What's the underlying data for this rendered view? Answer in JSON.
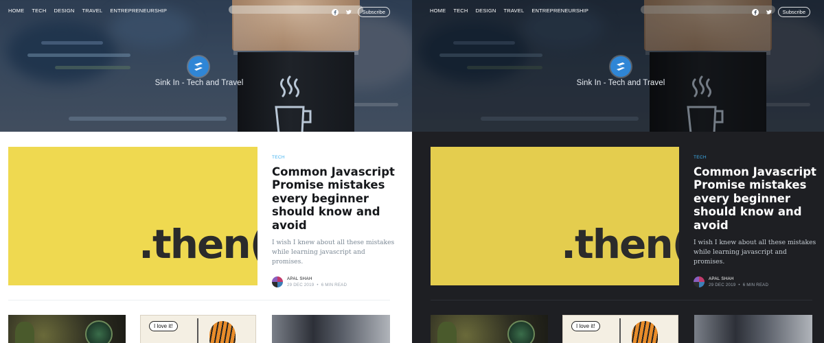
{
  "nav": {
    "items": [
      "HOME",
      "TECH",
      "DESIGN",
      "TRAVEL",
      "ENTREPRENEURSHIP"
    ],
    "subscribe_label": "Subscribe"
  },
  "site": {
    "name": "Sink In - Tech and Travel"
  },
  "featured": {
    "tag": "TECH",
    "title": "Common Javascript Promise mistakes every beginner should know and avoid",
    "excerpt": "I wish I knew about all these mistakes while learning javascript and promises.",
    "image_text": ".then(",
    "author": "APAL SHAH",
    "date": "29 DEC 2019",
    "read_time": "6 MIN READ"
  },
  "cards": {
    "comic_bubble": "I love it!"
  },
  "themes": {
    "left": "light",
    "right": "dark"
  },
  "colors": {
    "accent": "#3eb0ef",
    "logo": "#2f86d6",
    "feature_yellow": "#efd950",
    "dark_bg": "#1e1f23"
  },
  "icons": [
    "facebook-icon",
    "twitter-icon",
    "logo-icon",
    "coffee-cup-icon"
  ]
}
